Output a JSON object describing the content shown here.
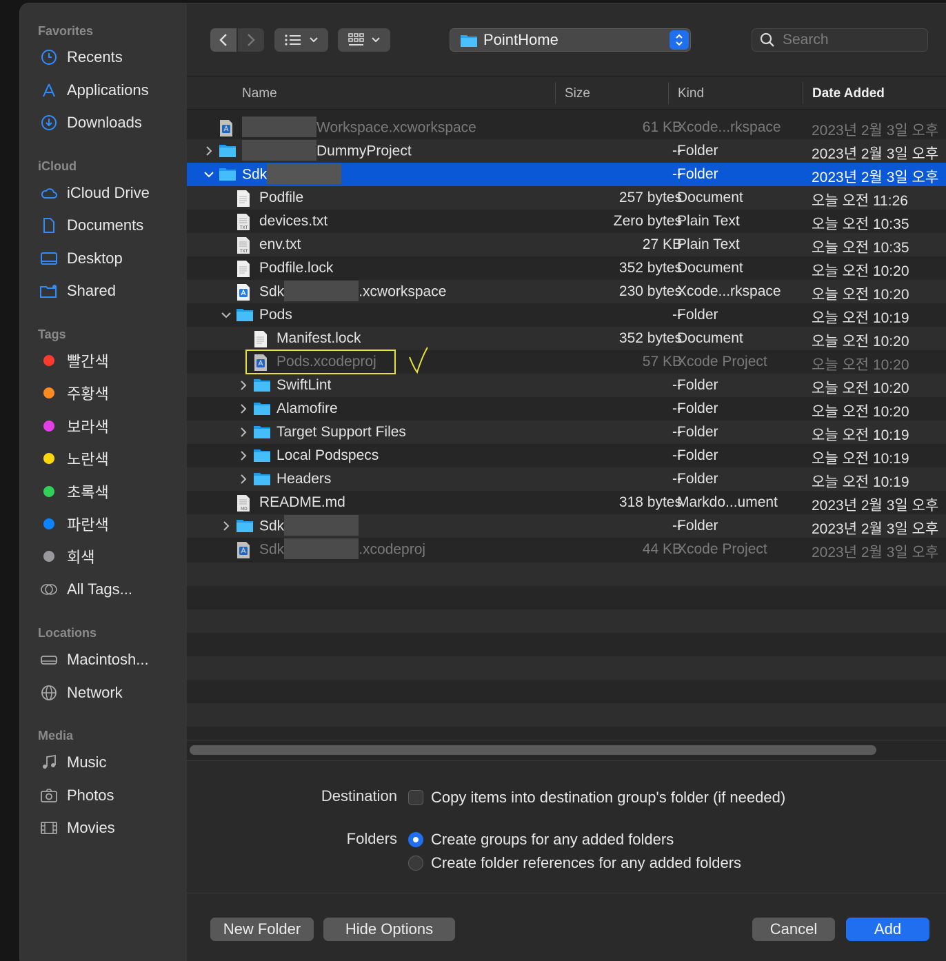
{
  "sidebar": {
    "favorites_title": "Favorites",
    "favorites": [
      {
        "label": "Recents",
        "icon": "clock-icon"
      },
      {
        "label": "Applications",
        "icon": "applications-icon"
      },
      {
        "label": "Downloads",
        "icon": "download-icon"
      }
    ],
    "icloud_title": "iCloud",
    "icloud": [
      {
        "label": "iCloud Drive",
        "icon": "cloud-icon"
      },
      {
        "label": "Documents",
        "icon": "document-icon"
      },
      {
        "label": "Desktop",
        "icon": "desktop-icon"
      },
      {
        "label": "Shared",
        "icon": "shared-folder-icon"
      }
    ],
    "tags_title": "Tags",
    "tags": [
      {
        "label": "빨간색",
        "color": "#ff3b30"
      },
      {
        "label": "주황색",
        "color": "#ff8a1f"
      },
      {
        "label": "보라색",
        "color": "#e43fe6"
      },
      {
        "label": "노란색",
        "color": "#ffd60a"
      },
      {
        "label": "초록색",
        "color": "#30d158"
      },
      {
        "label": "파란색",
        "color": "#0a84ff"
      },
      {
        "label": "회색",
        "color": "#98989d"
      }
    ],
    "all_tags": "All Tags...",
    "locations_title": "Locations",
    "locations": [
      {
        "label": "Macintosh...",
        "icon": "hard-drive-icon"
      },
      {
        "label": "Network",
        "icon": "globe-icon"
      }
    ],
    "media_title": "Media",
    "media": [
      {
        "label": "Music",
        "icon": "music-icon"
      },
      {
        "label": "Photos",
        "icon": "camera-icon"
      },
      {
        "label": "Movies",
        "icon": "film-icon"
      }
    ]
  },
  "toolbar": {
    "path": "PointHome",
    "search_placeholder": "Search"
  },
  "columns": {
    "name": "Name",
    "size": "Size",
    "kind": "Kind",
    "date": "Date Added"
  },
  "rows": [
    {
      "name_suffix": "Workspace.xcworkspace",
      "redacted": true,
      "size": "61 KB",
      "kind": "Xcode...rkspace",
      "date": "2023년 2월 3일 오후",
      "icon": "xcworkspace-icon",
      "depth": 0,
      "disclosure": "none",
      "dim": true
    },
    {
      "name_suffix": "DummyProject",
      "redacted": true,
      "size": "--",
      "kind": "Folder",
      "date": "2023년 2월 3일 오후",
      "icon": "folder-icon",
      "depth": 0,
      "disclosure": "closed",
      "dim": false
    },
    {
      "name_prefix": "Sdk",
      "redacted": true,
      "name_suffix": "",
      "size": "--",
      "kind": "Folder",
      "date": "2023년 2월 3일 오후",
      "icon": "folder-icon",
      "depth": 0,
      "disclosure": "open",
      "selected": true
    },
    {
      "name_suffix": "Podfile",
      "size": "257 bytes",
      "kind": "Document",
      "date": "오늘 오전 11:26",
      "icon": "document-icon",
      "depth": 1,
      "disclosure": "none"
    },
    {
      "name_suffix": "devices.txt",
      "size": "Zero bytes",
      "kind": "Plain Text",
      "date": "오늘 오전 10:35",
      "icon": "text-file-icon",
      "depth": 1,
      "disclosure": "none"
    },
    {
      "name_suffix": "env.txt",
      "size": "27 KB",
      "kind": "Plain Text",
      "date": "오늘 오전 10:35",
      "icon": "text-file-icon",
      "depth": 1,
      "disclosure": "none"
    },
    {
      "name_suffix": "Podfile.lock",
      "size": "352 bytes",
      "kind": "Document",
      "date": "오늘 오전 10:20",
      "icon": "document-icon",
      "depth": 1,
      "disclosure": "none"
    },
    {
      "name_prefix": "Sdk",
      "redacted": true,
      "name_suffix": ".xcworkspace",
      "size": "230 bytes",
      "kind": "Xcode...rkspace",
      "date": "오늘 오전 10:20",
      "icon": "xcworkspace-icon",
      "depth": 1,
      "disclosure": "none"
    },
    {
      "name_suffix": "Pods",
      "size": "--",
      "kind": "Folder",
      "date": "오늘 오전 10:19",
      "icon": "folder-icon",
      "depth": 1,
      "disclosure": "open"
    },
    {
      "name_suffix": "Manifest.lock",
      "size": "352 bytes",
      "kind": "Document",
      "date": "오늘 오전 10:20",
      "icon": "document-icon",
      "depth": 2,
      "disclosure": "none"
    },
    {
      "name_suffix": "Pods.xcodeproj",
      "size": "57 KB",
      "kind": "Xcode Project",
      "date": "오늘 오전 10:20",
      "icon": "xcodeproj-icon",
      "depth": 2,
      "disclosure": "none",
      "dim": true,
      "highlighted": true
    },
    {
      "name_suffix": "SwiftLint",
      "size": "--",
      "kind": "Folder",
      "date": "오늘 오전 10:20",
      "icon": "folder-icon",
      "depth": 2,
      "disclosure": "closed"
    },
    {
      "name_suffix": "Alamofire",
      "size": "--",
      "kind": "Folder",
      "date": "오늘 오전 10:20",
      "icon": "folder-icon",
      "depth": 2,
      "disclosure": "closed"
    },
    {
      "name_suffix": "Target Support Files",
      "size": "--",
      "kind": "Folder",
      "date": "오늘 오전 10:19",
      "icon": "folder-icon",
      "depth": 2,
      "disclosure": "closed"
    },
    {
      "name_suffix": "Local Podspecs",
      "size": "--",
      "kind": "Folder",
      "date": "오늘 오전 10:19",
      "icon": "folder-icon",
      "depth": 2,
      "disclosure": "closed"
    },
    {
      "name_suffix": "Headers",
      "size": "--",
      "kind": "Folder",
      "date": "오늘 오전 10:19",
      "icon": "folder-icon",
      "depth": 2,
      "disclosure": "closed"
    },
    {
      "name_suffix": "README.md",
      "size": "318 bytes",
      "kind": "Markdo...ument",
      "date": "2023년 2월 3일 오후",
      "icon": "markdown-file-icon",
      "depth": 1,
      "disclosure": "none"
    },
    {
      "name_prefix": "Sdk",
      "redacted": true,
      "name_suffix": "",
      "size": "--",
      "kind": "Folder",
      "date": "2023년 2월 3일 오후",
      "icon": "folder-icon",
      "depth": 1,
      "disclosure": "closed"
    },
    {
      "name_prefix": "Sdk",
      "redacted": true,
      "name_suffix": ".xcodeproj",
      "size": "44 KB",
      "kind": "Xcode Project",
      "date": "2023년 2월 3일 오후",
      "icon": "xcodeproj-icon",
      "depth": 1,
      "disclosure": "none",
      "dim": true
    }
  ],
  "options": {
    "destination_label": "Destination",
    "copy_items": "Copy items into destination group's folder (if needed)",
    "folders_label": "Folders",
    "create_groups": "Create groups for any added folders",
    "create_references": "Create folder references for any added folders"
  },
  "buttons": {
    "new_folder": "New Folder",
    "hide_options": "Hide Options",
    "cancel": "Cancel",
    "add": "Add"
  },
  "colors": {
    "accent": "#1f6ff0",
    "selection": "#0b58d6",
    "annotation": "#e8e23a"
  }
}
